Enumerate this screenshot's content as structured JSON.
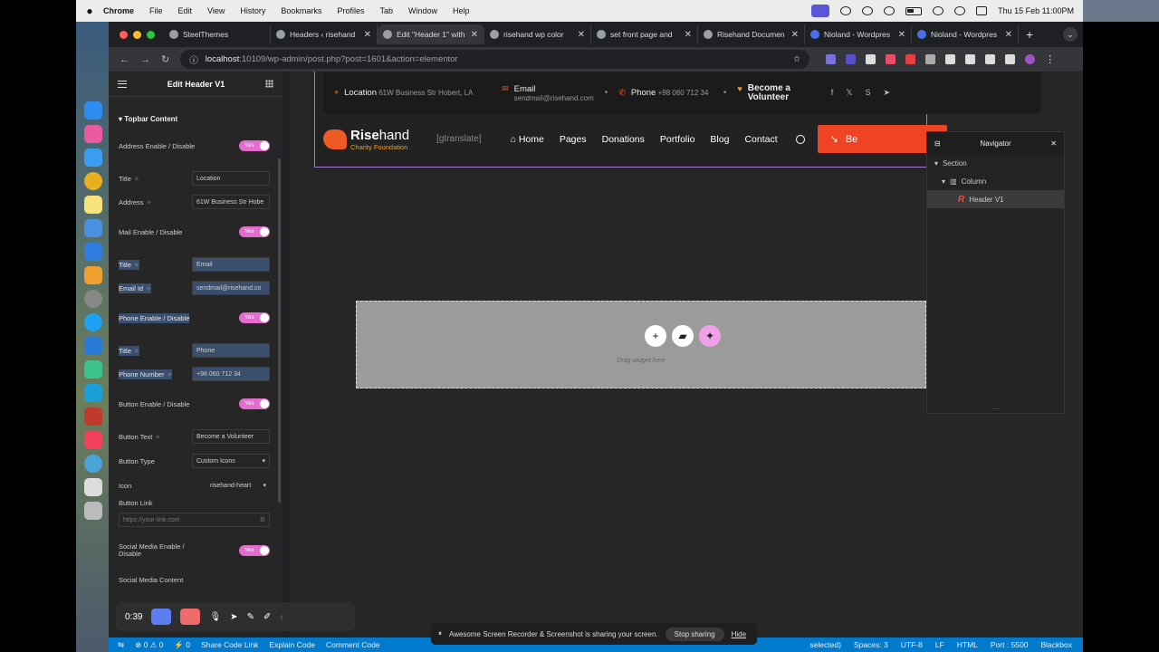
{
  "menubar": {
    "app": "Chrome",
    "items": [
      "File",
      "Edit",
      "View",
      "History",
      "Bookmarks",
      "Profiles",
      "Tab",
      "Window",
      "Help"
    ],
    "datetime": "Thu 15 Feb  11:00PM"
  },
  "tabs": [
    {
      "label": "SteelThemes",
      "active": false
    },
    {
      "label": "Headers ‹ risehand",
      "active": false
    },
    {
      "label": "Edit \"Header 1\" with",
      "active": true
    },
    {
      "label": "risehand wp color",
      "active": false
    },
    {
      "label": "set front page and",
      "active": false
    },
    {
      "label": "Risehand Documen",
      "active": false
    },
    {
      "label": "Nioland - Wordpres",
      "active": false
    },
    {
      "label": "Nioland - Wordpres",
      "active": false
    }
  ],
  "address": {
    "host": "localhost",
    "path": ":10109/wp-admin/post.php?post=1601&action=elementor"
  },
  "panel": {
    "title": "Edit Header V1",
    "section": "Topbar Content",
    "rows": [
      {
        "label": "Address Enable / Disable",
        "type": "toggle",
        "value": "Yes"
      },
      {
        "label": "Title",
        "type": "input",
        "value": "Location"
      },
      {
        "label": "Address",
        "type": "input",
        "value": "61W Business Str Hobe"
      },
      {
        "label": "Mail Enable / Disable",
        "type": "toggle",
        "value": "Yes"
      },
      {
        "label": "Title",
        "type": "input",
        "value": "Email"
      },
      {
        "label": "Email Id",
        "type": "input",
        "value": "sendmail@risehand.co"
      },
      {
        "label": "Phone Enable / Disable",
        "type": "toggle",
        "value": "Yes"
      },
      {
        "label": "Title",
        "type": "input",
        "value": "Phone"
      },
      {
        "label": "Phone Number",
        "type": "input",
        "value": "+98 060 712 34"
      },
      {
        "label": "Button Enable / Disable",
        "type": "toggle",
        "value": "Yes"
      },
      {
        "label": "Button Text",
        "type": "input",
        "value": "Become a Volunteer"
      },
      {
        "label": "Button Type",
        "type": "select",
        "value": "Custom Icons"
      },
      {
        "label": "Icon",
        "type": "iconsel",
        "value": "risehand-heart"
      },
      {
        "label": "Button Link",
        "type": "label",
        "value": ""
      },
      {
        "label": "Social Media Enable / Disable",
        "type": "toggle",
        "value": "Yes"
      },
      {
        "label": "Social Media Content",
        "type": "label",
        "value": ""
      }
    ],
    "link_placeholder": "https://your-link.com"
  },
  "preview": {
    "topbar": {
      "location_title": "Location",
      "location_value": "61W Business Str Hobert, LA",
      "email_title": "Email",
      "email_value": "sendmail@risehand.com",
      "phone_title": "Phone",
      "phone_value": "+98 060 712 34",
      "volunteer": "Become a Volunteer"
    },
    "logo_name_bold": "Rise",
    "logo_name_rest": "hand",
    "logo_sub": "Charity Foundation",
    "gtranslate": "[gtranslate]",
    "nav": [
      "Home",
      "Pages",
      "Donations",
      "Portfolio",
      "Blog",
      "Contact"
    ],
    "cta": "Be",
    "drop_hint": "Drag widget here"
  },
  "navigator": {
    "title": "Navigator",
    "items": [
      "Section",
      "Column",
      "Header V1"
    ]
  },
  "recorder": {
    "time": "0:39"
  },
  "share": {
    "message": "Awesome Screen Recorder & Screenshot is sharing your screen.",
    "stop": "Stop sharing",
    "hide": "Hide"
  },
  "statusbar": {
    "left": [
      "⊗ 0 ⚠ 0",
      "⚡ 0",
      "Share Code Link",
      "Explain Code",
      "Comment Code"
    ],
    "right": [
      "selected)",
      "Spaces: 3",
      "UTF-8",
      "LF",
      "HTML",
      "Port : 5500",
      "Blackbox"
    ]
  }
}
